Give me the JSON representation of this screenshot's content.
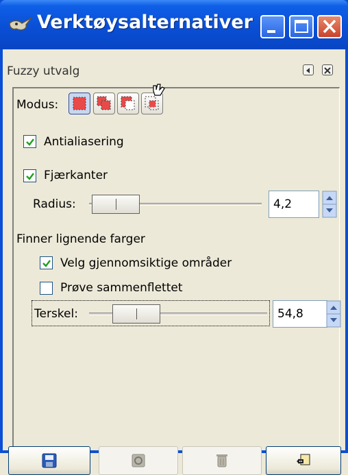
{
  "window": {
    "title": "Verktøysalternativer",
    "controls": [
      "minimize",
      "maximize",
      "close"
    ]
  },
  "panel": {
    "title": "Fuzzy utvalg"
  },
  "mode": {
    "label": "Modus:",
    "buttons": [
      "replace-selection-icon",
      "add-selection-icon",
      "subtract-selection-icon",
      "intersect-selection-icon"
    ]
  },
  "options": {
    "antialias": {
      "label": "Antialiasering",
      "checked": true
    },
    "feather": {
      "label": "Fjærkanter",
      "checked": true
    },
    "radius": {
      "label": "Radius:",
      "value": "4,2"
    }
  },
  "similar": {
    "heading": "Finner lignende farger",
    "transparent": {
      "label": "Velg gjennomsiktige områder",
      "checked": true
    },
    "sample_merged": {
      "label": "Prøve sammenflettet",
      "checked": false
    },
    "threshold": {
      "label": "Terskel:",
      "value": "54,8"
    }
  },
  "bottom_buttons": [
    {
      "icon": "save-icon",
      "enabled": true
    },
    {
      "icon": "restore-icon",
      "enabled": false
    },
    {
      "icon": "delete-icon",
      "enabled": false
    },
    {
      "icon": "reset-icon",
      "enabled": true
    }
  ]
}
